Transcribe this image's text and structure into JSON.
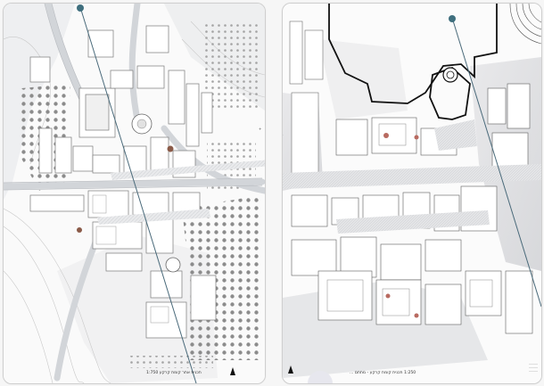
{
  "sheets": {
    "left": {
      "caption": "תכנית אתר קומת קרקע 1:750",
      "scale_mark": "+"
    },
    "right": {
      "caption": "1:250 תכנית קומת קרקע - מתחם ...",
      "info_lines": [
        "..........",
        "..........",
        ".........."
      ],
      "scale_mark": "-"
    }
  },
  "icons": {
    "north_arrow": "north-arrow-icon",
    "axis_marker": "axis-pin-icon"
  },
  "colors": {
    "axis_line": "#4a6a7a",
    "axis_pin": "#3f6f7e",
    "building_fill": "#ffffff",
    "road_gray": "#cdd0d4",
    "dot_gray": "#8a8a8a",
    "accent_brown": "#8a5a48",
    "accent_red": "#b86a60"
  }
}
